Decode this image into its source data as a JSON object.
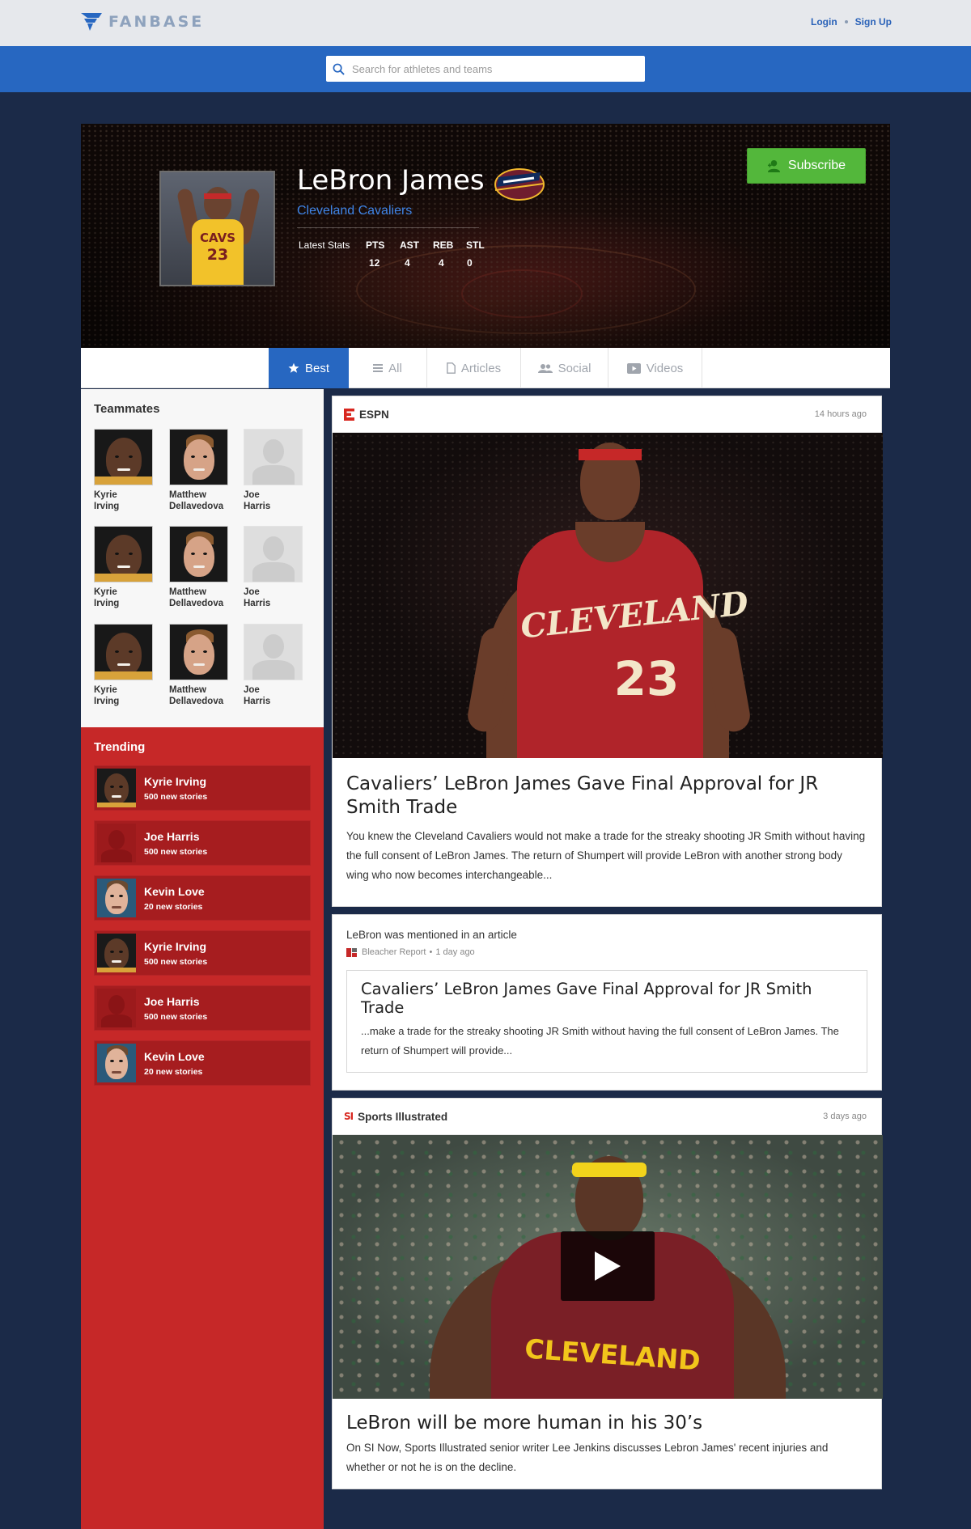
{
  "header": {
    "brand": "FANBASE",
    "login": "Login",
    "signup": "Sign Up"
  },
  "search": {
    "placeholder": "Search for athletes and teams"
  },
  "profile": {
    "name": "LeBron James",
    "team": "Cleveland Cavaliers",
    "jersey_text": "CAVS",
    "jersey_number": "23",
    "subscribe_label": "Subscribe",
    "stats_label": "Latest Stats",
    "stats": [
      {
        "label": "PTS",
        "value": "12"
      },
      {
        "label": "AST",
        "value": "4"
      },
      {
        "label": "REB",
        "value": "4"
      },
      {
        "label": "STL",
        "value": "0"
      }
    ]
  },
  "tabs": [
    {
      "label": "Best",
      "icon": "star-icon",
      "active": true
    },
    {
      "label": "All",
      "icon": "list-icon",
      "active": false
    },
    {
      "label": "Articles",
      "icon": "document-icon",
      "active": false
    },
    {
      "label": "Social",
      "icon": "people-icon",
      "active": false
    },
    {
      "label": "Videos",
      "icon": "video-icon",
      "active": false
    }
  ],
  "sidebar": {
    "teammates_title": "Teammates",
    "teammates": [
      {
        "first": "Kyrie",
        "last": "Irving"
      },
      {
        "first": "Matthew",
        "last": "Dellavedova"
      },
      {
        "first": "Joe",
        "last": "Harris"
      },
      {
        "first": "Kyrie",
        "last": "Irving"
      },
      {
        "first": "Matthew",
        "last": "Dellavedova"
      },
      {
        "first": "Joe",
        "last": "Harris"
      },
      {
        "first": "Kyrie",
        "last": "Irving"
      },
      {
        "first": "Matthew",
        "last": "Dellavedova"
      },
      {
        "first": "Joe",
        "last": "Harris"
      }
    ],
    "trending_title": "Trending",
    "trending": [
      {
        "name": "Kyrie Irving",
        "count": "500 new stories"
      },
      {
        "name": "Joe Harris",
        "count": "500 new stories"
      },
      {
        "name": "Kevin Love",
        "count": "20 new stories"
      },
      {
        "name": "Kyrie Irving",
        "count": "500 new stories"
      },
      {
        "name": "Joe Harris",
        "count": "500 new stories"
      },
      {
        "name": "Kevin Love",
        "count": "20 new stories"
      }
    ]
  },
  "feed": {
    "card1": {
      "source": "ESPN",
      "time": "14 hours ago",
      "image_jersey_text": "CLEVELAND",
      "image_jersey_number": "23",
      "headline": "Cavaliers’ LeBron James Gave Final Approval for JR Smith Trade",
      "excerpt": "You knew the Cleveland Cavaliers would not make a trade for the streaky shooting JR Smith without having the full consent of LeBron James. The return of Shumpert will provide LeBron with another strong body wing who now becomes interchangeable..."
    },
    "card2": {
      "title": "LeBron was mentioned in an article",
      "source": "Bleacher Report",
      "separator": "•",
      "time": "1 day ago",
      "quote_headline": "Cavaliers’ LeBron James Gave Final Approval for JR Smith Trade",
      "quote_text": "...make a trade for the streaky shooting JR Smith without having the full consent of LeBron James. The return of Shumpert will provide..."
    },
    "card3": {
      "source": "Sports Illustrated",
      "source_icon_text": "SI",
      "time": "3 days ago",
      "image_jersey_text": "CLEVELAND",
      "headline": "LeBron will be more human in his 30’s",
      "excerpt": "On SI Now, Sports Illustrated senior writer Lee Jenkins discusses Lebron James' recent injuries and whether or not he is on the decline."
    }
  },
  "colors": {
    "brand_blue": "#2767c1",
    "navy": "#1b2a48",
    "trending_red": "#c62828",
    "subscribe_green": "#53b73b"
  }
}
